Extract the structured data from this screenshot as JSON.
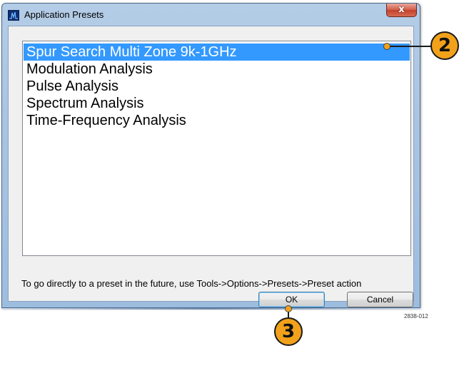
{
  "window": {
    "title": "Application Presets",
    "close_label": "x"
  },
  "presets": {
    "items": [
      "Spur Search Multi Zone 9k-1GHz",
      "Modulation Analysis",
      "Pulse Analysis",
      "Spectrum Analysis",
      "Time-Frequency Analysis"
    ],
    "selected_index": 0
  },
  "hint_text": "To go directly to a preset in the future, use Tools->Options->Presets->Preset action",
  "buttons": {
    "ok_label": "OK",
    "cancel_label": "Cancel"
  },
  "callouts": {
    "step_2": "2",
    "step_3": "3"
  },
  "figure_id": "2838-012",
  "colors": {
    "selection": "#3399ff",
    "callout_fill": "#f2a11a"
  }
}
